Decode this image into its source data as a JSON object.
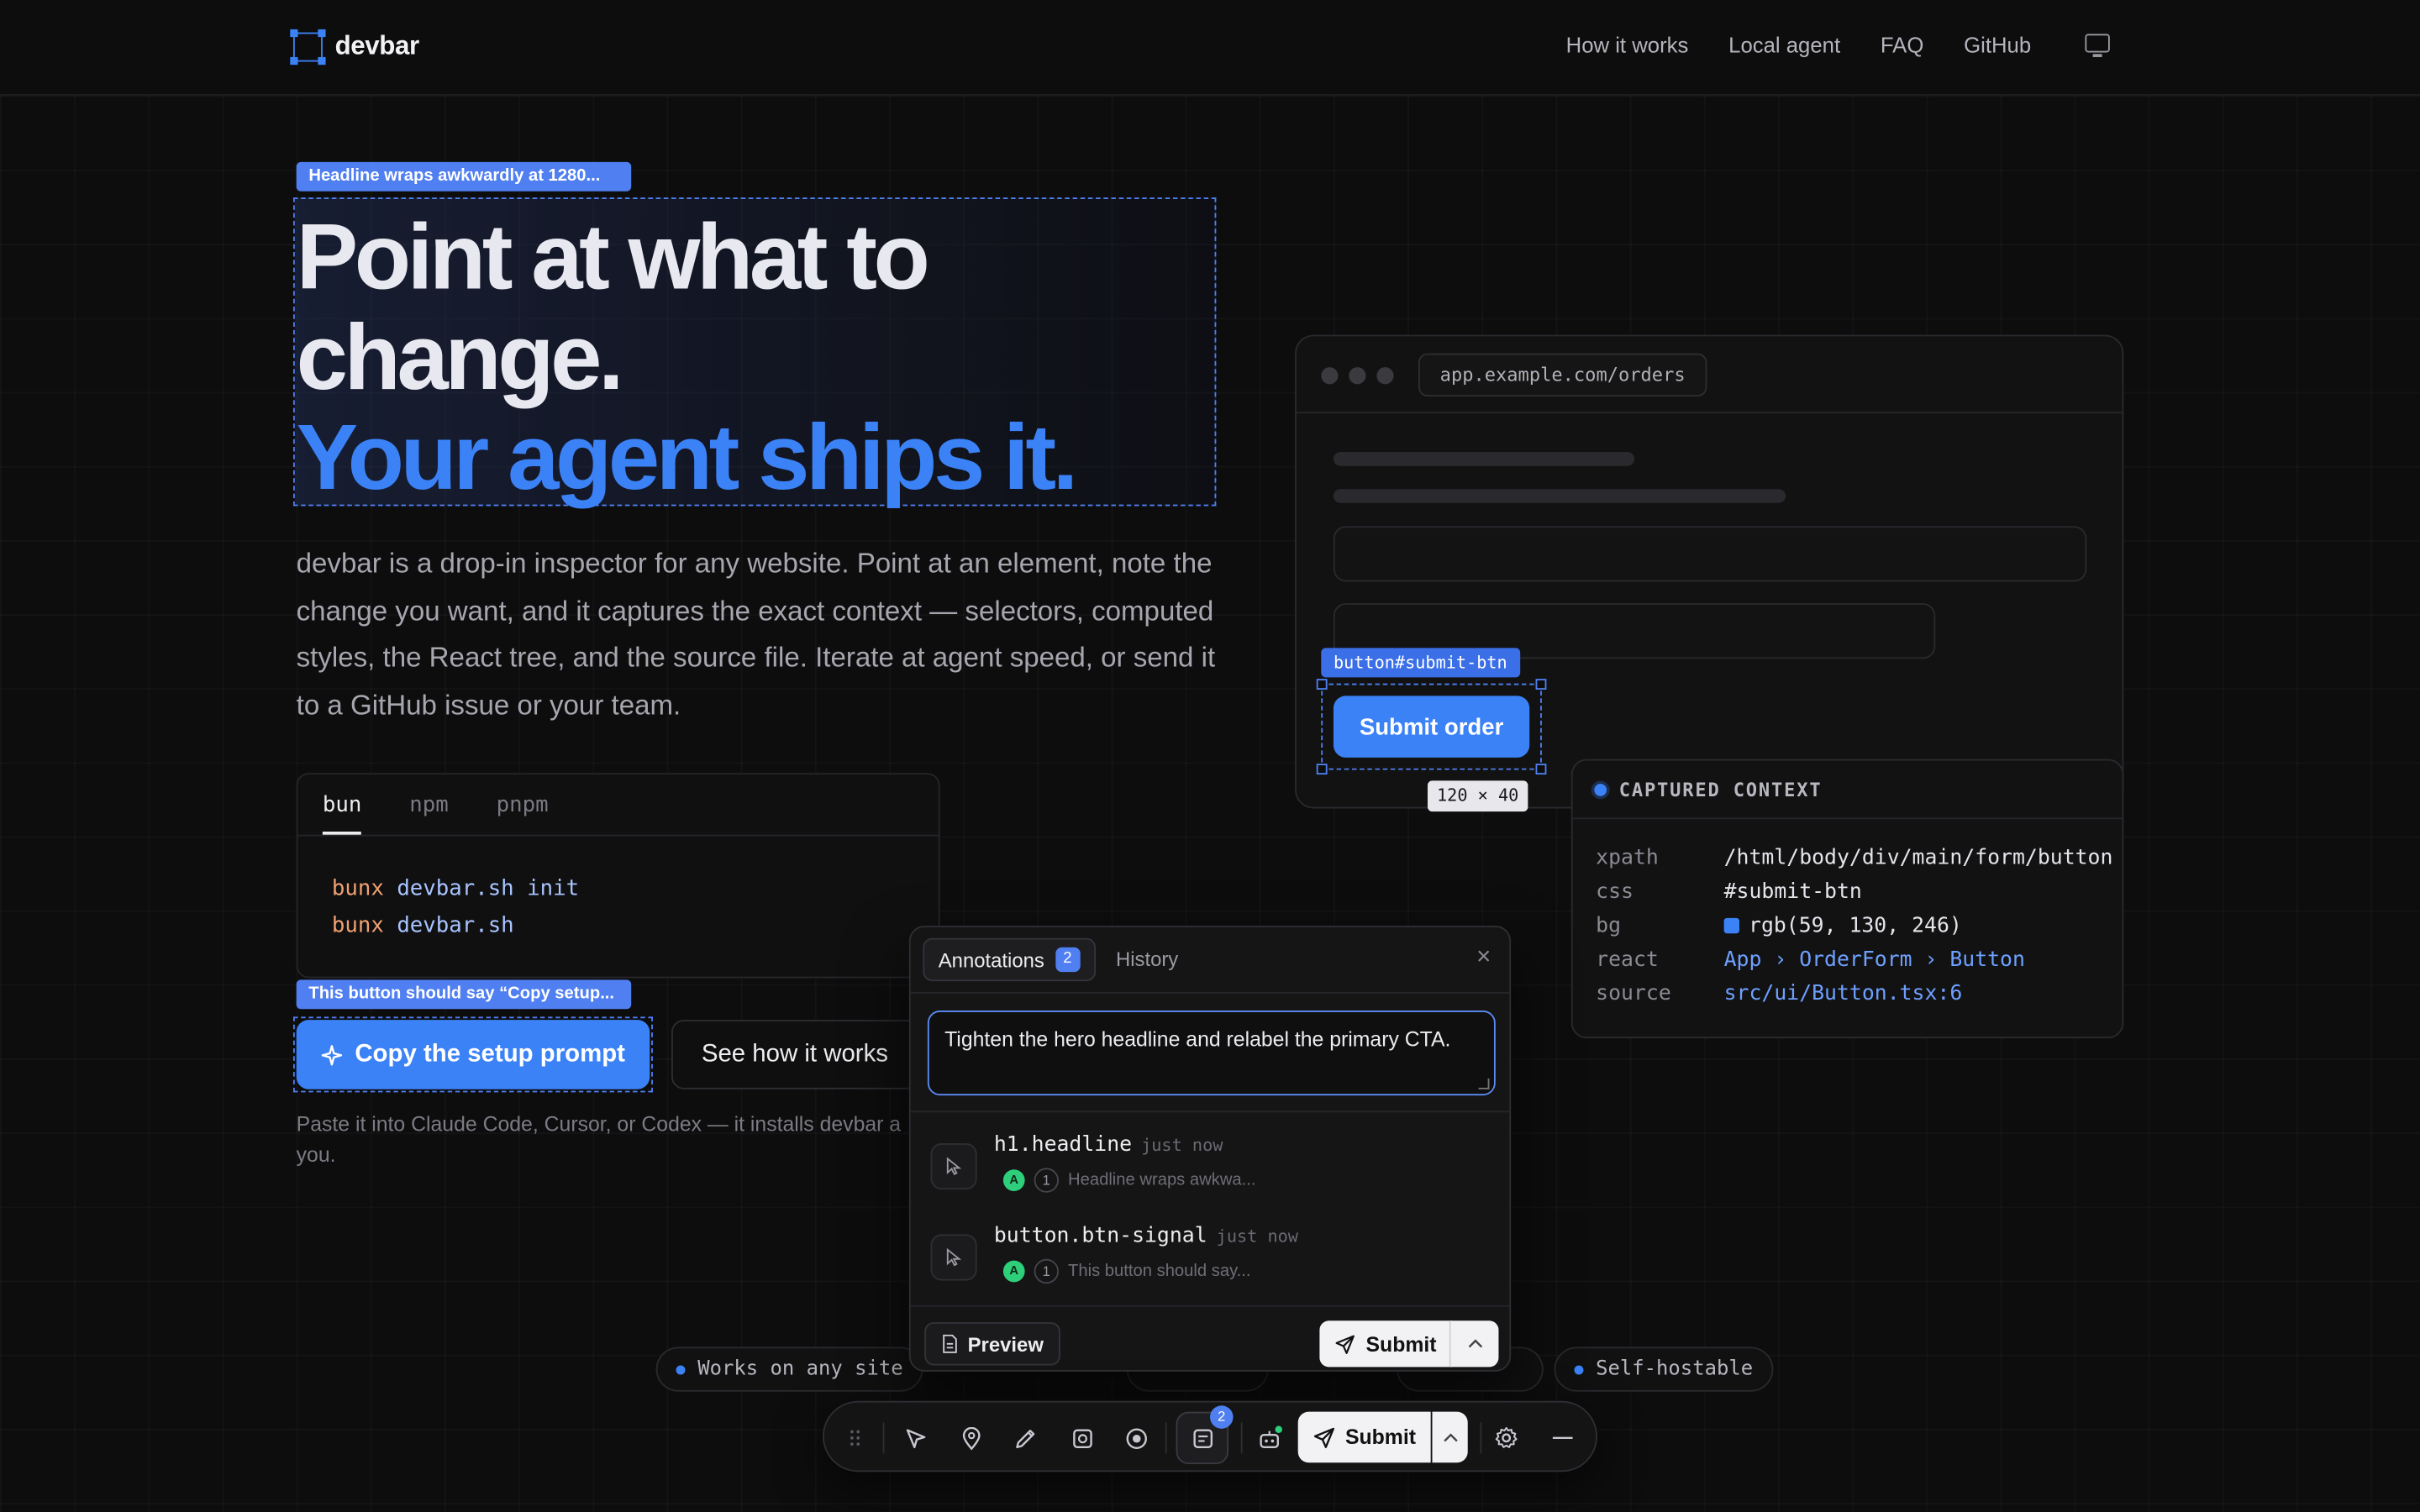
{
  "nav": {
    "brand": "devbar",
    "links": [
      "How it works",
      "Local agent",
      "FAQ",
      "GitHub"
    ],
    "theme_icon": "monitor-icon"
  },
  "hero": {
    "headline_tag": "Headline wraps awkwardly at 1280...",
    "headline_line1": "Point at what to",
    "headline_line2": "change.",
    "headline_line3": "Your agent ships it.",
    "lead": "devbar is a drop-in inspector for any website. Point at an element, note the change you want, and it captures the exact context — selectors, computed styles, the React tree, and the source file. Iterate at agent speed, or send it to a GitHub issue or your team."
  },
  "install": {
    "tabs": [
      "bun",
      "npm",
      "pnpm"
    ],
    "active_tab": "bun",
    "lines": [
      {
        "cmd": "bunx",
        "args": "devbar.sh init"
      },
      {
        "cmd": "bunx",
        "args": "devbar.sh"
      }
    ]
  },
  "cta": {
    "tag": "This button should say “Copy setup...",
    "primary": "Copy the setup prompt",
    "secondary": "See how it works",
    "hint": "Paste it into Claude Code, Cursor, or Codex — it installs devbar a you."
  },
  "mock": {
    "url": "app.example.com/orders",
    "selector_tag": "button#submit-btn",
    "button_label": "Submit order",
    "dimensions": "120 × 40"
  },
  "context": {
    "title": "CAPTURED CONTEXT",
    "rows": [
      {
        "key": "xpath",
        "value": "/html/body/div/main/form/button"
      },
      {
        "key": "css",
        "value": "#submit-btn"
      },
      {
        "key": "bg",
        "value": "rgb(59, 130, 246)"
      },
      {
        "key": "react",
        "value": "App › OrderForm › Button"
      },
      {
        "key": "source",
        "value": "src/ui/Button.tsx:6"
      }
    ],
    "bg_swatch": "#3b82f6"
  },
  "pills": [
    "Works on any site",
    "Self-hostable"
  ],
  "panel": {
    "tab_annotations": "Annotations",
    "annotation_count": "2",
    "tab_history": "History",
    "close": "×",
    "note": "Tighten the hero headline and relabel the primary CTA.",
    "items": [
      {
        "selector": "h1.headline",
        "time": "just now",
        "avatar": "A",
        "count": "1",
        "snippet": "Headline wraps awkwa..."
      },
      {
        "selector": "button.btn-signal",
        "time": "just now",
        "avatar": "A",
        "count": "1",
        "snippet": "This button should say..."
      }
    ],
    "preview": "Preview",
    "submit": "Submit"
  },
  "toolbar": {
    "badge": "2",
    "submit": "Submit"
  },
  "colors": {
    "accent": "#3b82f6",
    "background": "#0d0d0e",
    "agent_status": "#2ecf7a"
  }
}
